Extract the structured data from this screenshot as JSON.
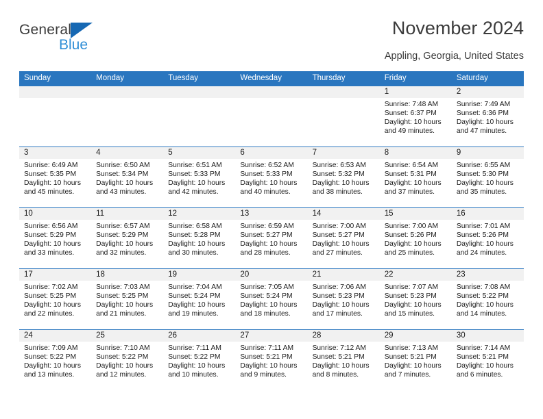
{
  "brand": {
    "name_top": "General",
    "name_bottom": "Blue",
    "color_dark": "#3c3c3c",
    "color_blue": "#2f8ed6",
    "triangle_color": "#1668b3"
  },
  "header": {
    "title": "November 2024",
    "subtitle": "Appling, Georgia, United States"
  },
  "theme": {
    "header_row_bg": "#2a76bf",
    "header_row_text": "#ffffff",
    "day_number_bg": "#f1f1f1",
    "row_divider": "#2a76bf",
    "body_text": "#1a1a1a"
  },
  "weekdays": [
    "Sunday",
    "Monday",
    "Tuesday",
    "Wednesday",
    "Thursday",
    "Friday",
    "Saturday"
  ],
  "weeks": [
    [
      {
        "day": "",
        "empty": true
      },
      {
        "day": "",
        "empty": true
      },
      {
        "day": "",
        "empty": true
      },
      {
        "day": "",
        "empty": true
      },
      {
        "day": "",
        "empty": true
      },
      {
        "day": "1",
        "sunrise": "Sunrise: 7:48 AM",
        "sunset": "Sunset: 6:37 PM",
        "daylight_1": "Daylight: 10 hours",
        "daylight_2": "and 49 minutes."
      },
      {
        "day": "2",
        "sunrise": "Sunrise: 7:49 AM",
        "sunset": "Sunset: 6:36 PM",
        "daylight_1": "Daylight: 10 hours",
        "daylight_2": "and 47 minutes."
      }
    ],
    [
      {
        "day": "3",
        "sunrise": "Sunrise: 6:49 AM",
        "sunset": "Sunset: 5:35 PM",
        "daylight_1": "Daylight: 10 hours",
        "daylight_2": "and 45 minutes."
      },
      {
        "day": "4",
        "sunrise": "Sunrise: 6:50 AM",
        "sunset": "Sunset: 5:34 PM",
        "daylight_1": "Daylight: 10 hours",
        "daylight_2": "and 43 minutes."
      },
      {
        "day": "5",
        "sunrise": "Sunrise: 6:51 AM",
        "sunset": "Sunset: 5:33 PM",
        "daylight_1": "Daylight: 10 hours",
        "daylight_2": "and 42 minutes."
      },
      {
        "day": "6",
        "sunrise": "Sunrise: 6:52 AM",
        "sunset": "Sunset: 5:33 PM",
        "daylight_1": "Daylight: 10 hours",
        "daylight_2": "and 40 minutes."
      },
      {
        "day": "7",
        "sunrise": "Sunrise: 6:53 AM",
        "sunset": "Sunset: 5:32 PM",
        "daylight_1": "Daylight: 10 hours",
        "daylight_2": "and 38 minutes."
      },
      {
        "day": "8",
        "sunrise": "Sunrise: 6:54 AM",
        "sunset": "Sunset: 5:31 PM",
        "daylight_1": "Daylight: 10 hours",
        "daylight_2": "and 37 minutes."
      },
      {
        "day": "9",
        "sunrise": "Sunrise: 6:55 AM",
        "sunset": "Sunset: 5:30 PM",
        "daylight_1": "Daylight: 10 hours",
        "daylight_2": "and 35 minutes."
      }
    ],
    [
      {
        "day": "10",
        "sunrise": "Sunrise: 6:56 AM",
        "sunset": "Sunset: 5:29 PM",
        "daylight_1": "Daylight: 10 hours",
        "daylight_2": "and 33 minutes."
      },
      {
        "day": "11",
        "sunrise": "Sunrise: 6:57 AM",
        "sunset": "Sunset: 5:29 PM",
        "daylight_1": "Daylight: 10 hours",
        "daylight_2": "and 32 minutes."
      },
      {
        "day": "12",
        "sunrise": "Sunrise: 6:58 AM",
        "sunset": "Sunset: 5:28 PM",
        "daylight_1": "Daylight: 10 hours",
        "daylight_2": "and 30 minutes."
      },
      {
        "day": "13",
        "sunrise": "Sunrise: 6:59 AM",
        "sunset": "Sunset: 5:27 PM",
        "daylight_1": "Daylight: 10 hours",
        "daylight_2": "and 28 minutes."
      },
      {
        "day": "14",
        "sunrise": "Sunrise: 7:00 AM",
        "sunset": "Sunset: 5:27 PM",
        "daylight_1": "Daylight: 10 hours",
        "daylight_2": "and 27 minutes."
      },
      {
        "day": "15",
        "sunrise": "Sunrise: 7:00 AM",
        "sunset": "Sunset: 5:26 PM",
        "daylight_1": "Daylight: 10 hours",
        "daylight_2": "and 25 minutes."
      },
      {
        "day": "16",
        "sunrise": "Sunrise: 7:01 AM",
        "sunset": "Sunset: 5:26 PM",
        "daylight_1": "Daylight: 10 hours",
        "daylight_2": "and 24 minutes."
      }
    ],
    [
      {
        "day": "17",
        "sunrise": "Sunrise: 7:02 AM",
        "sunset": "Sunset: 5:25 PM",
        "daylight_1": "Daylight: 10 hours",
        "daylight_2": "and 22 minutes."
      },
      {
        "day": "18",
        "sunrise": "Sunrise: 7:03 AM",
        "sunset": "Sunset: 5:25 PM",
        "daylight_1": "Daylight: 10 hours",
        "daylight_2": "and 21 minutes."
      },
      {
        "day": "19",
        "sunrise": "Sunrise: 7:04 AM",
        "sunset": "Sunset: 5:24 PM",
        "daylight_1": "Daylight: 10 hours",
        "daylight_2": "and 19 minutes."
      },
      {
        "day": "20",
        "sunrise": "Sunrise: 7:05 AM",
        "sunset": "Sunset: 5:24 PM",
        "daylight_1": "Daylight: 10 hours",
        "daylight_2": "and 18 minutes."
      },
      {
        "day": "21",
        "sunrise": "Sunrise: 7:06 AM",
        "sunset": "Sunset: 5:23 PM",
        "daylight_1": "Daylight: 10 hours",
        "daylight_2": "and 17 minutes."
      },
      {
        "day": "22",
        "sunrise": "Sunrise: 7:07 AM",
        "sunset": "Sunset: 5:23 PM",
        "daylight_1": "Daylight: 10 hours",
        "daylight_2": "and 15 minutes."
      },
      {
        "day": "23",
        "sunrise": "Sunrise: 7:08 AM",
        "sunset": "Sunset: 5:22 PM",
        "daylight_1": "Daylight: 10 hours",
        "daylight_2": "and 14 minutes."
      }
    ],
    [
      {
        "day": "24",
        "sunrise": "Sunrise: 7:09 AM",
        "sunset": "Sunset: 5:22 PM",
        "daylight_1": "Daylight: 10 hours",
        "daylight_2": "and 13 minutes."
      },
      {
        "day": "25",
        "sunrise": "Sunrise: 7:10 AM",
        "sunset": "Sunset: 5:22 PM",
        "daylight_1": "Daylight: 10 hours",
        "daylight_2": "and 12 minutes."
      },
      {
        "day": "26",
        "sunrise": "Sunrise: 7:11 AM",
        "sunset": "Sunset: 5:22 PM",
        "daylight_1": "Daylight: 10 hours",
        "daylight_2": "and 10 minutes."
      },
      {
        "day": "27",
        "sunrise": "Sunrise: 7:11 AM",
        "sunset": "Sunset: 5:21 PM",
        "daylight_1": "Daylight: 10 hours",
        "daylight_2": "and 9 minutes."
      },
      {
        "day": "28",
        "sunrise": "Sunrise: 7:12 AM",
        "sunset": "Sunset: 5:21 PM",
        "daylight_1": "Daylight: 10 hours",
        "daylight_2": "and 8 minutes."
      },
      {
        "day": "29",
        "sunrise": "Sunrise: 7:13 AM",
        "sunset": "Sunset: 5:21 PM",
        "daylight_1": "Daylight: 10 hours",
        "daylight_2": "and 7 minutes."
      },
      {
        "day": "30",
        "sunrise": "Sunrise: 7:14 AM",
        "sunset": "Sunset: 5:21 PM",
        "daylight_1": "Daylight: 10 hours",
        "daylight_2": "and 6 minutes."
      }
    ]
  ]
}
